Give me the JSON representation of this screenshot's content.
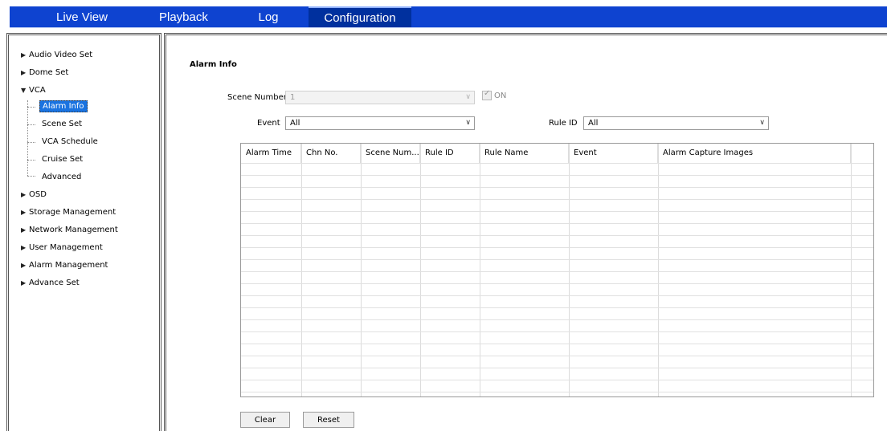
{
  "nav": {
    "tabs": [
      "Live View",
      "Playback",
      "Log",
      "Configuration"
    ],
    "active": "Configuration",
    "color_bar": "#0e43d0",
    "color_active": "#00309e"
  },
  "sidebar": {
    "top_items": [
      "Audio Video Set",
      "Dome Set",
      "VCA"
    ],
    "vca_children": [
      "Alarm Info",
      "Scene Set",
      "VCA Schedule",
      "Cruise Set",
      "Advanced"
    ],
    "bottom_items": [
      "OSD",
      "Storage Management",
      "Network Management",
      "User Management",
      "Alarm Management",
      "Advance Set"
    ],
    "selected": "Alarm Info",
    "selected_color": "#1a73e0"
  },
  "main": {
    "title": "Alarm Info",
    "scene_number_label": "Scene Number",
    "scene_number_value": "1",
    "scene_on_label": "ON",
    "event_label": "Event",
    "event_value": "All",
    "rule_id_label": "Rule ID",
    "rule_id_value": "All",
    "table_columns": [
      "Alarm Time",
      "Chn No.",
      "Scene Num...",
      "Rule ID",
      "Rule Name",
      "Event",
      "Alarm Capture Images"
    ],
    "clear_label": "Clear",
    "reset_label": "Reset"
  }
}
